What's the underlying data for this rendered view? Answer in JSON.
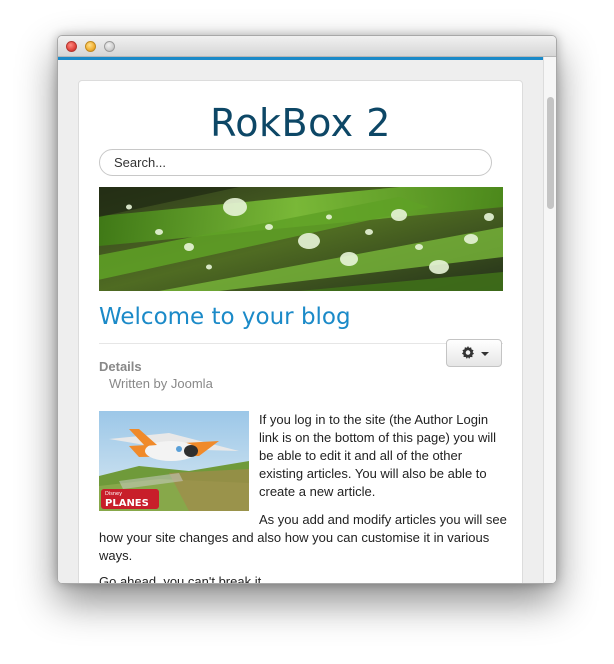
{
  "window": {
    "site_title": "RokBox 2"
  },
  "search": {
    "placeholder": "Search..."
  },
  "article": {
    "title": "Welcome to your blog",
    "details_label": "Details",
    "author": "Written by Joomla",
    "paragraphs": [
      "If you log in to the site (the Author Login link is on the bottom of this page) you will be able to edit it and all of the other existing articles. You will also be able to create a new article.",
      "As you add and modify articles you will see how your site changes and also how you can customise it in various ways.",
      "Go ahead, you can't break it."
    ],
    "image_caption_brand": "Disney",
    "image_caption_title": "PLANES"
  },
  "colors": {
    "accent": "#1b8ac8",
    "title": "#0d4766"
  },
  "icons": {
    "tools": "gear-icon",
    "dropdown": "caret-down-icon"
  }
}
